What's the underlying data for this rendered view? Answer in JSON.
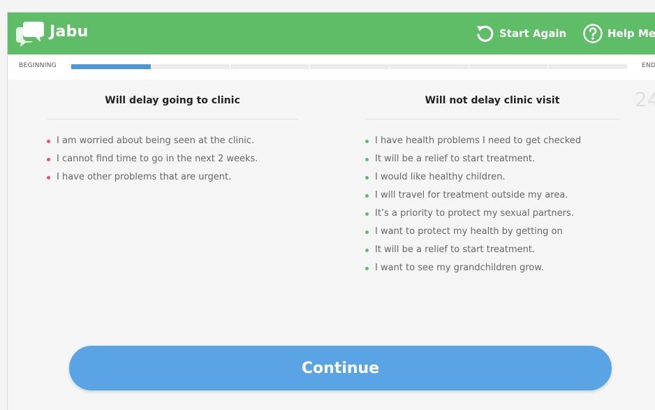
{
  "header": {
    "app_title": "Jabu",
    "start_again_label": "Start Again",
    "help_label": "Help Me",
    "color": "#5fbd67"
  },
  "progress": {
    "begin_label": "BEGINNING",
    "end_label": "END",
    "fraction": 0.145,
    "segments": 7
  },
  "counter": "24",
  "delay_column": {
    "title": "Will delay going to clinic",
    "items": [
      "I am worried about being seen at the clinic.",
      "I cannot find time to go in the next 2 weeks.",
      "I have other problems that are urgent."
    ]
  },
  "no_delay_column": {
    "title": "Will not delay clinic visit",
    "items": [
      "I have health problems I need to get checked",
      "It will be a relief to start treatment.",
      "I would like healthy children.",
      "I will travel for treatment outside my area.",
      "It’s a priority to protect my sexual partners.",
      "I want to protect my health by getting on",
      "It will be a relief to start treatment.",
      "I want to see my grandchildren grow."
    ]
  },
  "continue_label": "Continue",
  "colors": {
    "accent_blue": "#5aa4e6",
    "negative_dot": "#e0566b",
    "positive_dot": "#5fbd67"
  }
}
